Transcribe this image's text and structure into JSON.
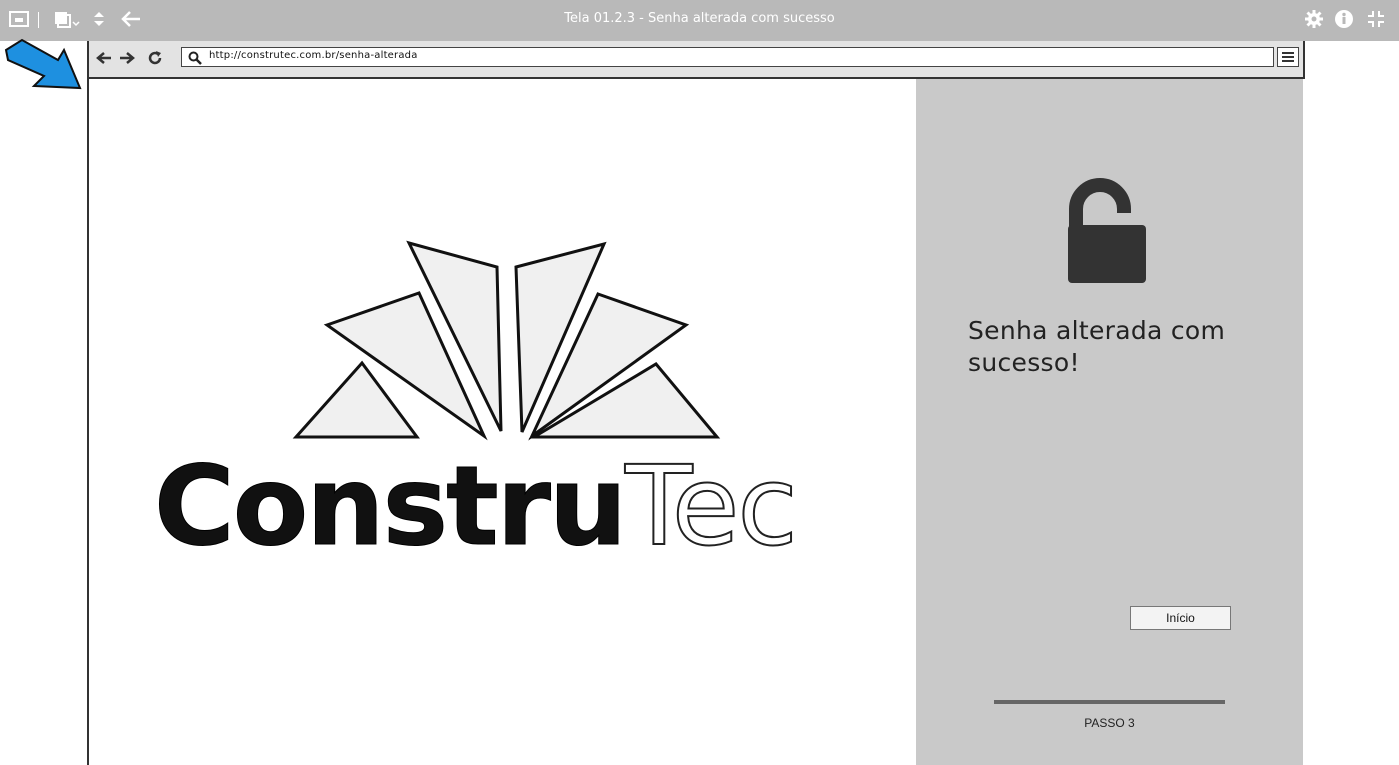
{
  "window": {
    "title": "Tela 01.2.3 - Senha alterada com sucesso"
  },
  "browser": {
    "url": "http://construtec.com.br/senha-alterada"
  },
  "logo": {
    "word_dark": "Constru",
    "word_light": "Tec"
  },
  "panel": {
    "message": "Senha alterada com sucesso!",
    "button_label": "Início",
    "step_label": "PASSO 3"
  },
  "colors": {
    "topbar": "#b9b9b9",
    "panel": "#c9c9c9",
    "annotation_arrow": "#1e90e0"
  },
  "icons": {
    "lock": "unlocked-padlock-icon"
  }
}
